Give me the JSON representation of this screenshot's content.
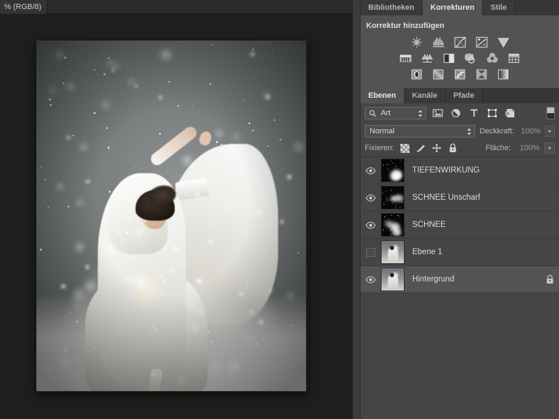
{
  "document": {
    "tab_title": "% (RGB/8)"
  },
  "adjustments_panel": {
    "tabs": [
      {
        "label": "Bibliotheken",
        "active": false
      },
      {
        "label": "Korrekturen",
        "active": true
      },
      {
        "label": "Stile",
        "active": false
      }
    ],
    "title": "Korrektur hinzufügen",
    "rows": [
      [
        {
          "icon": "brightness-contrast-icon",
          "label": "Helligkeit/Kontrast"
        },
        {
          "icon": "levels-icon",
          "label": "Tonwertkorrektur"
        },
        {
          "icon": "curves-icon",
          "label": "Gradationskurven"
        },
        {
          "icon": "exposure-icon",
          "label": "Belichtung"
        },
        {
          "icon": "vibrance-icon",
          "label": "Dynamik"
        }
      ],
      [
        {
          "icon": "hue-saturation-icon",
          "label": "Farbton/Sättigung"
        },
        {
          "icon": "color-balance-icon",
          "label": "Farbbalance"
        },
        {
          "icon": "black-white-icon",
          "label": "Schwarzweiß"
        },
        {
          "icon": "photo-filter-icon",
          "label": "Fotofilter"
        },
        {
          "icon": "channel-mixer-icon",
          "label": "Kanalmixer"
        },
        {
          "icon": "color-lookup-icon",
          "label": "Color-Lookup"
        }
      ],
      [
        {
          "icon": "invert-icon",
          "label": "Umkehren"
        },
        {
          "icon": "posterize-icon",
          "label": "Tontrennung"
        },
        {
          "icon": "threshold-icon",
          "label": "Schwellenwert"
        },
        {
          "icon": "selective-color-icon",
          "label": "Selektive Farbkorrektur"
        },
        {
          "icon": "gradient-map-icon",
          "label": "Verlaufsumsetzung"
        }
      ]
    ]
  },
  "layers_panel": {
    "tabs": [
      {
        "label": "Ebenen",
        "active": true
      },
      {
        "label": "Kanäle",
        "active": false
      },
      {
        "label": "Pfade",
        "active": false
      }
    ],
    "filter": {
      "kind_label": "Art",
      "icons": [
        {
          "icon": "pixel-layer-filter-icon"
        },
        {
          "icon": "adjustment-layer-filter-icon"
        },
        {
          "icon": "type-layer-filter-icon"
        },
        {
          "icon": "shape-layer-filter-icon"
        },
        {
          "icon": "smart-object-filter-icon"
        }
      ],
      "toggle": "filter-enable-toggle"
    },
    "blend": {
      "mode": "Normal",
      "opacity_label": "Deckkraft:",
      "opacity_value": "100%"
    },
    "lock": {
      "label": "Fixieren:",
      "icons": [
        {
          "icon": "lock-transparency-icon"
        },
        {
          "icon": "lock-image-icon"
        },
        {
          "icon": "lock-position-icon"
        },
        {
          "icon": "lock-all-icon"
        }
      ],
      "fill_label": "Fläche:",
      "fill_value": "100%"
    },
    "layers": [
      {
        "name": "TIEFENWIRKUNG",
        "visible": true,
        "selected": false,
        "locked": false,
        "thumb": "dark"
      },
      {
        "name": "SCHNEE Unscharf",
        "visible": true,
        "selected": false,
        "locked": false,
        "thumb": "dark"
      },
      {
        "name": "SCHNEE",
        "visible": true,
        "selected": false,
        "locked": false,
        "thumb": "dark"
      },
      {
        "name": "Ebene 1",
        "visible": false,
        "selected": false,
        "locked": false,
        "thumb": "photo"
      },
      {
        "name": "Hintergrund",
        "visible": true,
        "selected": true,
        "locked": true,
        "thumb": "photo"
      }
    ]
  },
  "colors": {
    "panel_bg": "#454545",
    "panel_light": "#535353",
    "tab_bg": "#363636",
    "selected_row": "#545454",
    "text": "#dcdcdc",
    "canvas_bg": "#1e1e1e"
  }
}
